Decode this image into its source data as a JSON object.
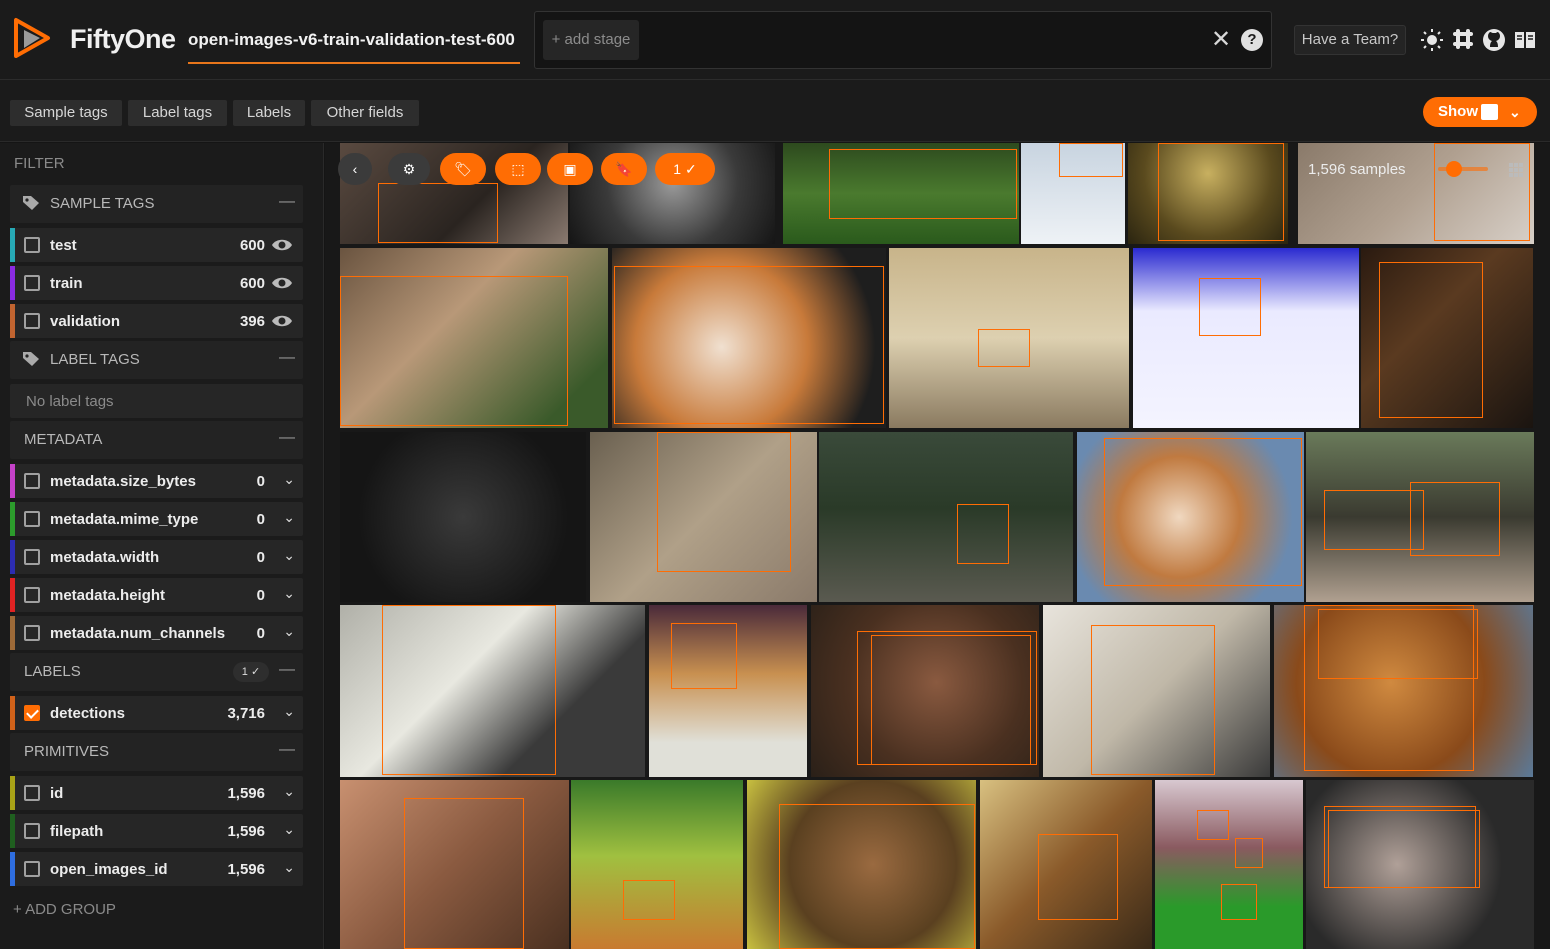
{
  "header": {
    "brand": "FiftyOne",
    "dataset_name": "open-images-v6-train-validation-test-600",
    "add_stage": "+ add stage",
    "team_button": "Have a Team?",
    "close_glyph": "✕",
    "help_glyph": "?",
    "icons": [
      "close-icon",
      "help-icon",
      "theme-icon",
      "slack-icon",
      "github-icon",
      "docs-icon"
    ]
  },
  "tabs": [
    {
      "label": "Sample tags"
    },
    {
      "label": "Label tags"
    },
    {
      "label": "Labels"
    },
    {
      "label": "Other fields"
    }
  ],
  "show_button": {
    "label": "Show"
  },
  "sidebar": {
    "filter_title": "FILTER",
    "groups": {
      "sample_tags": "SAMPLE TAGS",
      "label_tags": "LABEL TAGS",
      "metadata": "METADATA",
      "labels": "LABELS",
      "primitives": "PRIMITIVES"
    },
    "no_label_tags": "No label tags",
    "labels_badge": "1 ✓",
    "add_group": "+ ADD GROUP",
    "sample_tags": [
      {
        "label": "test",
        "count": "600",
        "color": "#27a9b5"
      },
      {
        "label": "train",
        "count": "600",
        "color": "#8a2be2"
      },
      {
        "label": "validation",
        "count": "396",
        "color": "#c16430"
      }
    ],
    "metadata": [
      {
        "label": "metadata.size_bytes",
        "count": "0",
        "color": "#c542c9"
      },
      {
        "label": "metadata.mime_type",
        "count": "0",
        "color": "#2c9c2c"
      },
      {
        "label": "metadata.width",
        "count": "0",
        "color": "#2c2cb0"
      },
      {
        "label": "metadata.height",
        "count": "0",
        "color": "#e02323"
      },
      {
        "label": "metadata.num_channels",
        "count": "0",
        "color": "#9d6a38"
      }
    ],
    "labels": [
      {
        "label": "detections",
        "count": "3,716",
        "color": "#d1621a",
        "checked": true
      }
    ],
    "primitives": [
      {
        "label": "id",
        "count": "1,596",
        "color": "#a8a217"
      },
      {
        "label": "filepath",
        "count": "1,596",
        "color": "#1f5f1f"
      },
      {
        "label": "open_images_id",
        "count": "1,596",
        "color": "#2f6ee0"
      }
    ]
  },
  "grid": {
    "sample_count": "1,596 samples",
    "selected_badge": "1 ✓",
    "colors": {
      "accent": "#ff6d04",
      "box": "#ff6d04"
    }
  }
}
